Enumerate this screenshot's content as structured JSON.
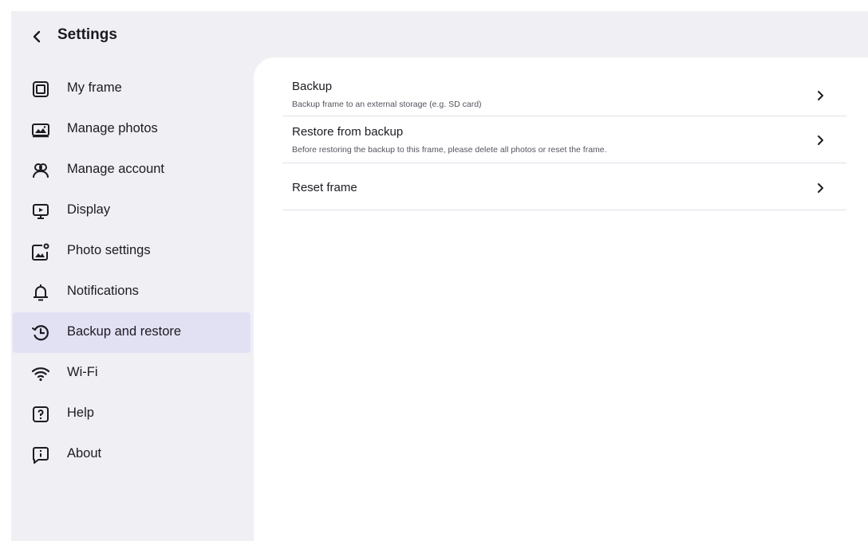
{
  "header": {
    "title": "Settings",
    "back_icon": "chevron-left-icon"
  },
  "sidebar": {
    "items": [
      {
        "label": "My frame",
        "icon": "frame-icon"
      },
      {
        "label": "Manage photos",
        "icon": "photos-icon"
      },
      {
        "label": "Manage account",
        "icon": "account-icon"
      },
      {
        "label": "Display",
        "icon": "display-icon"
      },
      {
        "label": "Photo settings",
        "icon": "photo-settings-icon"
      },
      {
        "label": "Notifications",
        "icon": "bell-icon"
      },
      {
        "label": "Backup and restore",
        "icon": "backup-restore-icon",
        "active": true
      },
      {
        "label": "Wi-Fi",
        "icon": "wifi-icon"
      },
      {
        "label": "Help",
        "icon": "help-icon"
      },
      {
        "label": "About",
        "icon": "info-icon"
      }
    ]
  },
  "main": {
    "rows": [
      {
        "title": "Backup",
        "subtitle": "Backup frame to an external storage (e.g. SD card)",
        "icon": "chevron-right-icon"
      },
      {
        "title": "Restore from backup",
        "subtitle": "Before restoring the backup to this frame, please delete all photos or reset the frame.",
        "icon": "chevron-right-icon"
      },
      {
        "title": "Reset frame",
        "subtitle": "",
        "icon": "chevron-right-icon"
      }
    ]
  },
  "colors": {
    "sidebar_bg": "#efeff4",
    "active_bg": "#e2e0f3",
    "content_bg": "#ffffff",
    "text": "#1c1b22",
    "divider": "#e0e0ea"
  }
}
